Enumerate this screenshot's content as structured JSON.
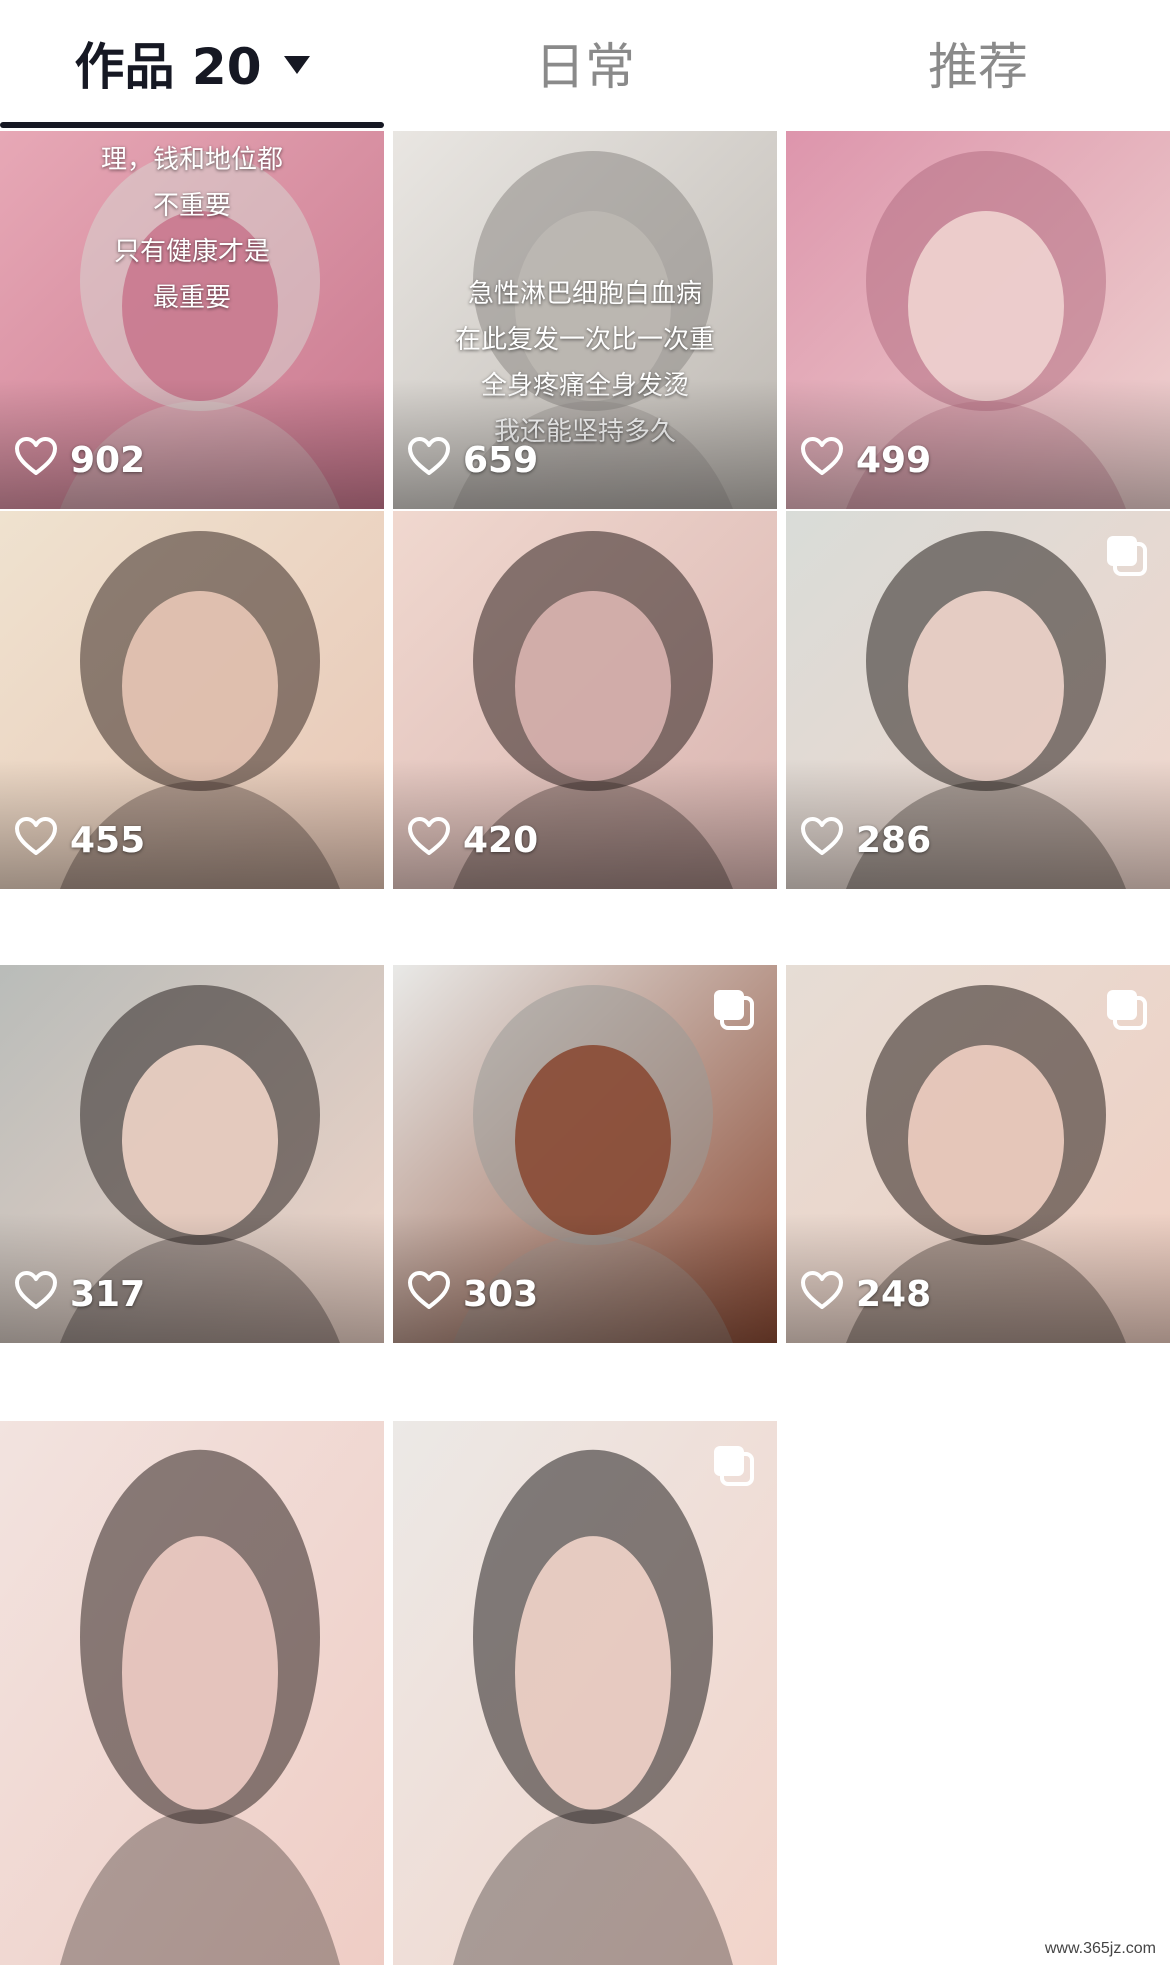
{
  "tabs": [
    {
      "label": "作品 20",
      "active": true
    },
    {
      "label": "日常",
      "active": false
    },
    {
      "label": "推荐",
      "active": false
    }
  ],
  "posts": [
    {
      "likes": "902",
      "multi": false,
      "caption": [
        "理，钱和地位都",
        "不重要",
        "只有健康才是",
        "最重要"
      ],
      "palette": [
        "#e7a8b6",
        "#c9788e",
        "#d7d3cf"
      ]
    },
    {
      "likes": "659",
      "multi": false,
      "caption": [
        "急性淋巴细胞白血病",
        "在此复发一次比一次重",
        "全身疼痛全身发烫",
        "我还能坚持多久"
      ],
      "palette": [
        "#e9e6e2",
        "#bdb8b2",
        "#8e8a86"
      ]
    },
    {
      "likes": "499",
      "multi": false,
      "caption": [],
      "palette": [
        "#dd95ac",
        "#efd3d0",
        "#b56f83"
      ]
    },
    {
      "likes": "455",
      "multi": false,
      "caption": [],
      "palette": [
        "#efe2cf",
        "#e8c7b6",
        "#3a2b27"
      ]
    },
    {
      "likes": "420",
      "multi": false,
      "caption": [],
      "palette": [
        "#f0d8cf",
        "#d9b4b0",
        "#2f2320"
      ]
    },
    {
      "likes": "286",
      "multi": true,
      "caption": [],
      "palette": [
        "#d9dcd8",
        "#f1d6cc",
        "#2a2420"
      ]
    },
    {
      "likes": "317",
      "multi": false,
      "caption": [],
      "palette": [
        "#b9bcb9",
        "#efd4c8",
        "#2d2624"
      ]
    },
    {
      "likes": "303",
      "multi": true,
      "caption": [],
      "palette": [
        "#e9e9e7",
        "#8a4a34",
        "#9a9a98"
      ]
    },
    {
      "likes": "248",
      "multi": true,
      "caption": [],
      "palette": [
        "#e6ddd5",
        "#f0cfc2",
        "#2a211e"
      ]
    },
    {
      "likes": "",
      "multi": false,
      "caption": [],
      "palette": [
        "#f2e3df",
        "#efcdc5",
        "#2f2523"
      ]
    },
    {
      "likes": "",
      "multi": true,
      "caption": [],
      "palette": [
        "#ece9e6",
        "#f2d4ca",
        "#252020"
      ]
    }
  ],
  "watermark": "www.365jz.com",
  "colors": {
    "active_text": "#161823",
    "inactive_text": "#8a8a8a",
    "like_text": "#ffffff"
  }
}
